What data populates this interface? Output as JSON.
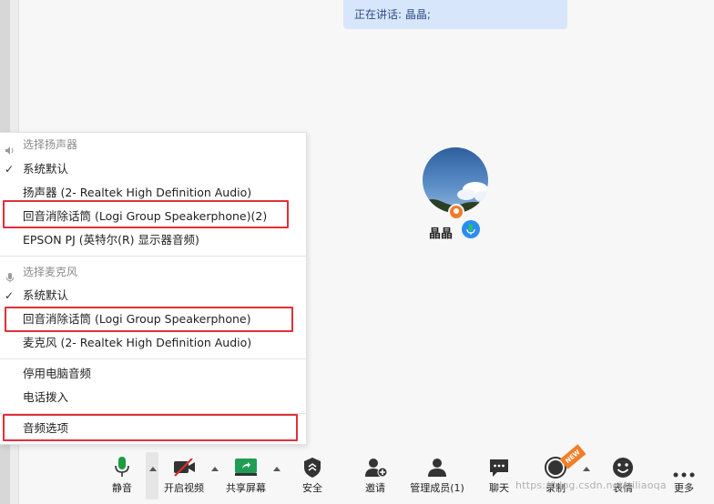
{
  "speaking_banner": {
    "text": "正在讲话: 晶晶;"
  },
  "participant": {
    "name": "晶晶"
  },
  "audio_menu": {
    "speaker_section": {
      "title": "选择扬声器",
      "items": [
        {
          "label": "系统默认",
          "checked": true
        },
        {
          "label": "扬声器 (2- Realtek High Definition Audio)",
          "checked": false
        },
        {
          "label": "回音消除话筒 (Logi Group Speakerphone)(2)",
          "checked": false
        },
        {
          "label": "EPSON PJ (英特尔(R) 显示器音频)",
          "checked": false
        }
      ]
    },
    "mic_section": {
      "title": "选择麦克风",
      "items": [
        {
          "label": "系统默认",
          "checked": true
        },
        {
          "label": "回音消除话筒 (Logi Group Speakerphone)",
          "checked": false
        },
        {
          "label": "麦克风 (2- Realtek High Definition Audio)",
          "checked": false
        }
      ]
    },
    "actions": [
      {
        "label": "停用电脑音频"
      },
      {
        "label": "电话拨入"
      }
    ],
    "audio_options": {
      "label": "音频选项"
    },
    "check_glyph": "✓"
  },
  "toolbar": {
    "mute": "静音",
    "start_video": "开启视频",
    "share_screen": "共享屏幕",
    "security": "安全",
    "invite": "邀请",
    "manage_participants": "管理成员(1)",
    "chat": "聊天",
    "record": "录制",
    "reactions": "表情",
    "more": "更多"
  },
  "colors": {
    "highlight": "#e0303a",
    "share_green": "#1f9d55",
    "mic_green": "#1a9e3f",
    "video_red": "#d9302c",
    "banner_bg": "#d8e6fb",
    "new_badge": "#f07f2a"
  },
  "watermark": "https://blog.csdn.net/ziliaoqa",
  "new_badge": "NEW"
}
